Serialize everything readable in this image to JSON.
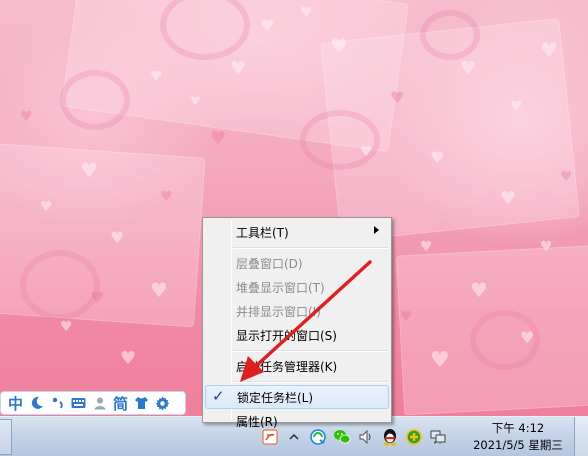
{
  "context_menu": {
    "items": [
      {
        "label": "工具栏(T)",
        "enabled": true,
        "has_submenu": true,
        "checked": false
      },
      {
        "separator": true
      },
      {
        "label": "层叠窗口(D)",
        "enabled": false,
        "checked": false
      },
      {
        "label": "堆叠显示窗口(T)",
        "enabled": false,
        "checked": false
      },
      {
        "label": "并排显示窗口(I)",
        "enabled": false,
        "checked": false
      },
      {
        "label": "显示打开的窗口(S)",
        "enabled": true,
        "checked": false
      },
      {
        "separator": true
      },
      {
        "label": "启动任务管理器(K)",
        "enabled": true,
        "checked": false
      },
      {
        "separator": true
      },
      {
        "label": "锁定任务栏(L)",
        "enabled": true,
        "checked": true,
        "highlighted": true
      },
      {
        "label": "属性(R)",
        "enabled": true,
        "checked": false
      }
    ]
  },
  "ime_bar": {
    "buttons": [
      {
        "icon": "chinese-mode-icon",
        "text": "中"
      },
      {
        "icon": "moon-halfwidth-icon",
        "text": ""
      },
      {
        "icon": "punctuation-icon",
        "text": ""
      },
      {
        "icon": "keyboard-icon",
        "text": ""
      },
      {
        "icon": "user-icon",
        "text": ""
      },
      {
        "icon": "simplified-icon",
        "text": "简"
      },
      {
        "icon": "shirt-skin-icon",
        "text": ""
      },
      {
        "icon": "settings-gear-icon",
        "text": ""
      }
    ]
  },
  "tray": {
    "icons": [
      "pen-input-icon",
      "show-hidden-icons-chevron",
      "qq-browser-icon",
      "wechat-icon",
      "volume-icon",
      "qq-penguin-icon",
      "security-plus-icon",
      "network-icon"
    ]
  },
  "clock": {
    "time": "下午 4:12",
    "date": "2021/5/5 星期三"
  },
  "colors": {
    "arrow": "#e02020",
    "menu_bg": "#f0f0f0",
    "highlight_border": "#aecff7",
    "ime_blue": "#2b78d3"
  }
}
